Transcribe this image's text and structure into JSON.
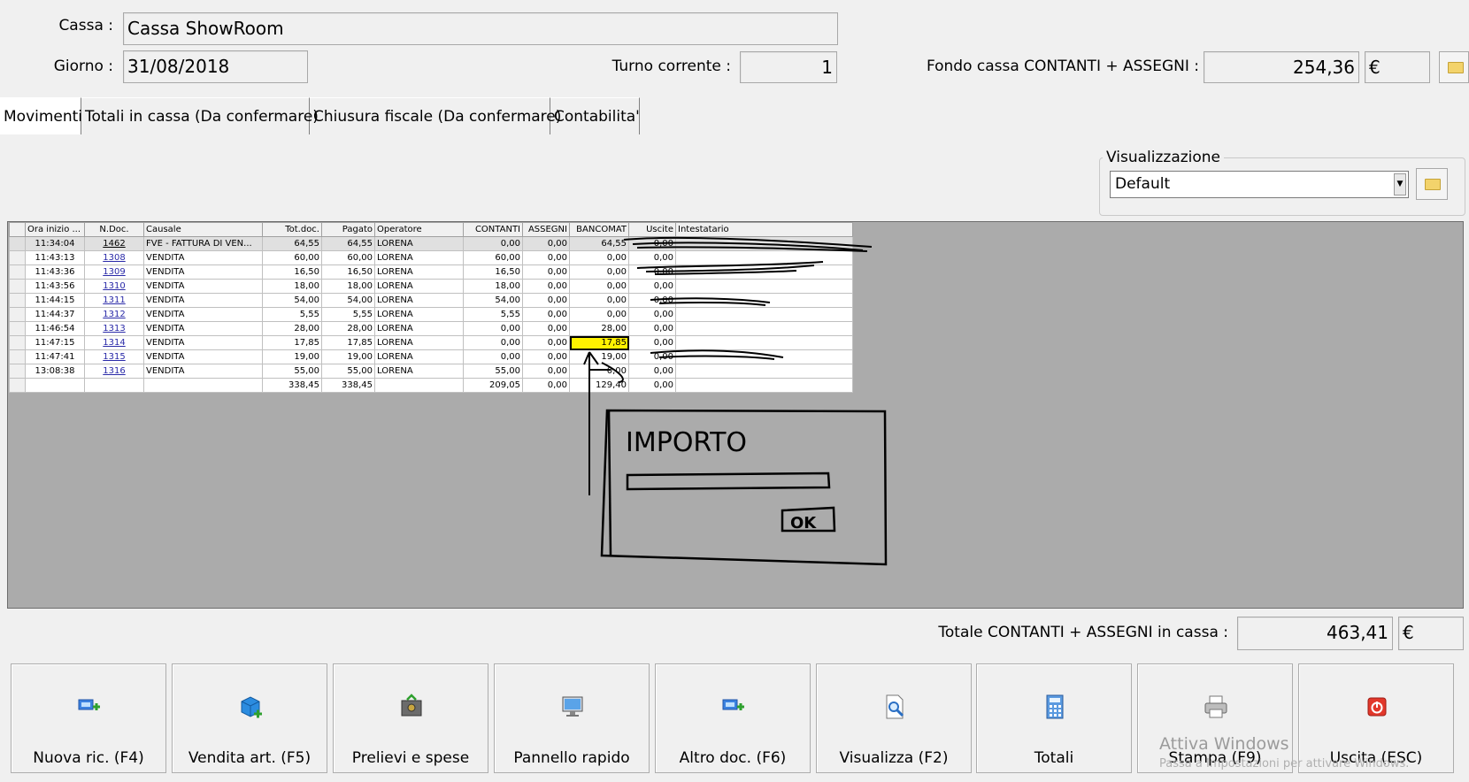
{
  "header": {
    "cassa_label": "Cassa :",
    "cassa_value": "Cassa ShowRoom",
    "giorno_label": "Giorno :",
    "giorno_value": "31/08/2018",
    "turno_label": "Turno corrente :",
    "turno_value": "1",
    "fondo_label": "Fondo cassa CONTANTI + ASSEGNI :",
    "fondo_value": "254,36",
    "currency": "€"
  },
  "tabs": [
    {
      "label": "Movimenti",
      "active": true
    },
    {
      "label": "Totali in cassa (Da confermare)"
    },
    {
      "label": "Chiusura fiscale (Da confermare)"
    },
    {
      "label": "Contabilita'"
    }
  ],
  "view": {
    "group_title": "Visualizzazione",
    "selected": "Default"
  },
  "grid": {
    "columns": [
      "Ora inizio ...",
      "N.Doc.",
      "Causale",
      "Tot.doc.",
      "Pagato",
      "Operatore",
      "CONTANTI",
      "ASSEGNI",
      "BANCOMAT",
      "Uscite",
      "Intestatario"
    ],
    "rows": [
      {
        "ora": "11:34:04",
        "ndoc": "1462",
        "causale": "FVE - FATTURA DI VEN...",
        "tot": "64,55",
        "pagato": "64,55",
        "op": "LORENA",
        "contanti": "0,00",
        "assegni": "0,00",
        "bancomat": "64,55",
        "uscite": "0,00",
        "intestatario": ""
      },
      {
        "ora": "11:43:13",
        "ndoc": "1308",
        "causale": "VENDITA",
        "tot": "60,00",
        "pagato": "60,00",
        "op": "LORENA",
        "contanti": "60,00",
        "assegni": "0,00",
        "bancomat": "0,00",
        "uscite": "0,00",
        "intestatario": ""
      },
      {
        "ora": "11:43:36",
        "ndoc": "1309",
        "causale": "VENDITA",
        "tot": "16,50",
        "pagato": "16,50",
        "op": "LORENA",
        "contanti": "16,50",
        "assegni": "0,00",
        "bancomat": "0,00",
        "uscite": "0,00",
        "intestatario": ""
      },
      {
        "ora": "11:43:56",
        "ndoc": "1310",
        "causale": "VENDITA",
        "tot": "18,00",
        "pagato": "18,00",
        "op": "LORENA",
        "contanti": "18,00",
        "assegni": "0,00",
        "bancomat": "0,00",
        "uscite": "0,00",
        "intestatario": ""
      },
      {
        "ora": "11:44:15",
        "ndoc": "1311",
        "causale": "VENDITA",
        "tot": "54,00",
        "pagato": "54,00",
        "op": "LORENA",
        "contanti": "54,00",
        "assegni": "0,00",
        "bancomat": "0,00",
        "uscite": "0,00",
        "intestatario": ""
      },
      {
        "ora": "11:44:37",
        "ndoc": "1312",
        "causale": "VENDITA",
        "tot": "5,55",
        "pagato": "5,55",
        "op": "LORENA",
        "contanti": "5,55",
        "assegni": "0,00",
        "bancomat": "0,00",
        "uscite": "0,00",
        "intestatario": ""
      },
      {
        "ora": "11:46:54",
        "ndoc": "1313",
        "causale": "VENDITA",
        "tot": "28,00",
        "pagato": "28,00",
        "op": "LORENA",
        "contanti": "0,00",
        "assegni": "0,00",
        "bancomat": "28,00",
        "uscite": "0,00",
        "intestatario": ""
      },
      {
        "ora": "11:47:15",
        "ndoc": "1314",
        "causale": "VENDITA",
        "tot": "17,85",
        "pagato": "17,85",
        "op": "LORENA",
        "contanti": "0,00",
        "assegni": "0,00",
        "bancomat": "17,85",
        "uscite": "0,00",
        "intestatario": ""
      },
      {
        "ora": "11:47:41",
        "ndoc": "1315",
        "causale": "VENDITA",
        "tot": "19,00",
        "pagato": "19,00",
        "op": "LORENA",
        "contanti": "0,00",
        "assegni": "0,00",
        "bancomat": "19,00",
        "uscite": "0,00",
        "intestatario": ""
      },
      {
        "ora": "13:08:38",
        "ndoc": "1316",
        "causale": "VENDITA",
        "tot": "55,00",
        "pagato": "55,00",
        "op": "LORENA",
        "contanti": "55,00",
        "assegni": "0,00",
        "bancomat": "0,00",
        "uscite": "0,00",
        "intestatario": ""
      }
    ],
    "totals": {
      "tot": "338,45",
      "pagato": "338,45",
      "contanti": "209,05",
      "assegni": "0,00",
      "bancomat": "129,40",
      "uscite": "0,00"
    }
  },
  "sketch": {
    "title": "IMPORTO",
    "ok": "OK"
  },
  "total": {
    "label": "Totale CONTANTI + ASSEGNI in cassa :",
    "value": "463,41",
    "currency": "€"
  },
  "buttons": [
    {
      "label": "Nuova ric. (F4)",
      "icon": "new-receipt-icon"
    },
    {
      "label": "Vendita art. (F5)",
      "icon": "sale-box-icon"
    },
    {
      "label": "Prelievi e spese",
      "icon": "safe-icon"
    },
    {
      "label": "Pannello rapido",
      "icon": "monitor-icon"
    },
    {
      "label": "Altro doc. (F6)",
      "icon": "new-doc-icon"
    },
    {
      "label": "Visualizza (F2)",
      "icon": "magnifier-doc-icon"
    },
    {
      "label": "Totali",
      "icon": "calculator-icon"
    },
    {
      "label": "Stampa (F9)",
      "icon": "printer-icon"
    },
    {
      "label": "Uscita (ESC)",
      "icon": "power-icon"
    }
  ],
  "watermark": {
    "title": "Attiva Windows",
    "subtitle": "Passa a Impostazioni per attivare Windows."
  },
  "colors": {
    "highlight": "#fff200",
    "link": "#2a2aa8",
    "grid_bg": "#ababab"
  }
}
